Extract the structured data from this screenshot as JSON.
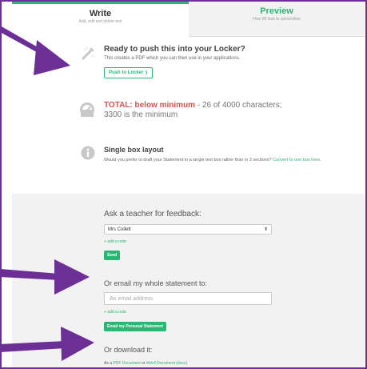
{
  "tabs": {
    "write": {
      "label": "Write",
      "sublabel": "Add, edit and delete text"
    },
    "preview": {
      "label": "Preview",
      "sublabel": "How it'll look to universities"
    }
  },
  "locker": {
    "title": "Ready to push this into your Locker?",
    "description": "This creates a PDF which you can then use in your applications.",
    "button_label": "Push to Locker",
    "button_chevron": "❯",
    "icon": "pencil-icon"
  },
  "total": {
    "icon": "speedometer-icon",
    "label": "TOTAL: below minimum",
    "separator": " - ",
    "count_text": "26 of 4000 characters;",
    "minimum_text": "3300 is the minimum"
  },
  "single_box": {
    "icon": "info-icon",
    "title": "Single box layout",
    "description": "Would you prefer to draft your Statement in a single text box rather than in 3 sections?",
    "link_text": "Convert to one box here."
  },
  "feedback": {
    "heading": "Ask a teacher for feedback:",
    "selected_teacher": "Mrs Collett",
    "add_note": "+ add a note",
    "send_label": "Send"
  },
  "email": {
    "heading": "Or email my whole statement to:",
    "placeholder": "An email address",
    "add_note": "+ add a note",
    "button_label": "Email my Personal Statement"
  },
  "download": {
    "heading": "Or download it:",
    "prefix": "As a ",
    "pdf_link": "PDF Document",
    "middle": " or ",
    "word_link": "Word Document (docx)"
  },
  "colors": {
    "accent_green": "#2bb673",
    "warning_red": "#d9534f",
    "annotation_purple": "#6b2f95"
  }
}
